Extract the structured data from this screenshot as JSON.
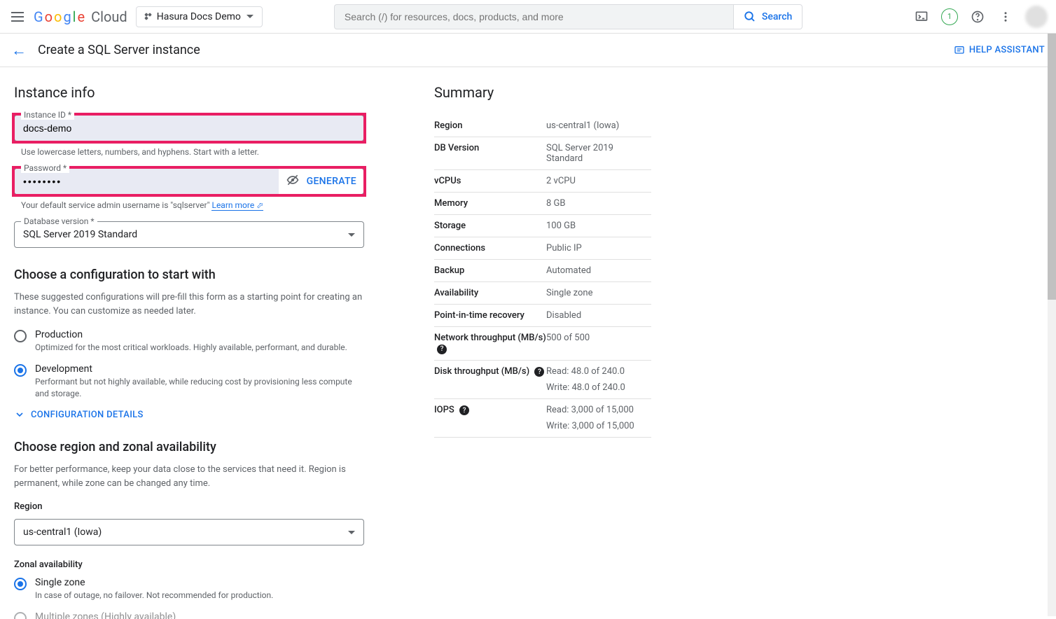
{
  "top": {
    "project": "Hasura Docs Demo",
    "search_placeholder": "Search (/) for resources, docs, products, and more",
    "search_btn": "Search",
    "badge": "1"
  },
  "header": {
    "title": "Create a SQL Server instance",
    "help": "HELP ASSISTANT"
  },
  "instance": {
    "section": "Instance info",
    "id_label": "Instance ID *",
    "id_value": "docs-demo",
    "id_help": "Use lowercase letters, numbers, and hyphens. Start with a letter.",
    "pwd_label": "Password *",
    "pwd_value": "••••••••",
    "generate": "GENERATE",
    "pwd_help_pre": "Your default service admin username is \"sqlserver\" ",
    "pwd_help_link": "Learn more",
    "dbv_label": "Database version *",
    "dbv_value": "SQL Server 2019 Standard"
  },
  "config": {
    "title": "Choose a configuration to start with",
    "desc": "These suggested configurations will pre-fill this form as a starting point for creating an instance. You can customize as needed later.",
    "prod_label": "Production",
    "prod_sub": "Optimized for the most critical workloads. Highly available, performant, and durable.",
    "dev_label": "Development",
    "dev_sub": "Performant but not highly available, while reducing cost by provisioning less compute and storage.",
    "expand": "CONFIGURATION DETAILS"
  },
  "region": {
    "title": "Choose region and zonal availability",
    "desc": "For better performance, keep your data close to the services that need it. Region is permanent, while zone can be changed any time.",
    "region_label": "Region",
    "region_value": "us-central1 (Iowa)",
    "zonal_label": "Zonal availability",
    "single_label": "Single zone",
    "single_sub": "In case of outage, no failover. Not recommended for production.",
    "multi_label": "Multiple zones (Highly available)"
  },
  "summary": {
    "title": "Summary",
    "rows": [
      {
        "k": "Region",
        "v": "us-central1 (Iowa)"
      },
      {
        "k": "DB Version",
        "v": "SQL Server 2019 Standard"
      },
      {
        "k": "vCPUs",
        "v": "2 vCPU"
      },
      {
        "k": "Memory",
        "v": "8 GB"
      },
      {
        "k": "Storage",
        "v": "100 GB"
      },
      {
        "k": "Connections",
        "v": "Public IP"
      },
      {
        "k": "Backup",
        "v": "Automated"
      },
      {
        "k": "Availability",
        "v": "Single zone"
      },
      {
        "k": "Point-in-time recovery",
        "v": "Disabled"
      }
    ],
    "nt_k": "Network throughput (MB/s)",
    "nt_v": "500 of 500",
    "dt_k": "Disk throughput (MB/s)",
    "dt_v1": "Read: 48.0 of 240.0",
    "dt_v2": "Write: 48.0 of 240.0",
    "io_k": "IOPS",
    "io_v1": "Read: 3,000 of 15,000",
    "io_v2": "Write: 3,000 of 15,000"
  }
}
